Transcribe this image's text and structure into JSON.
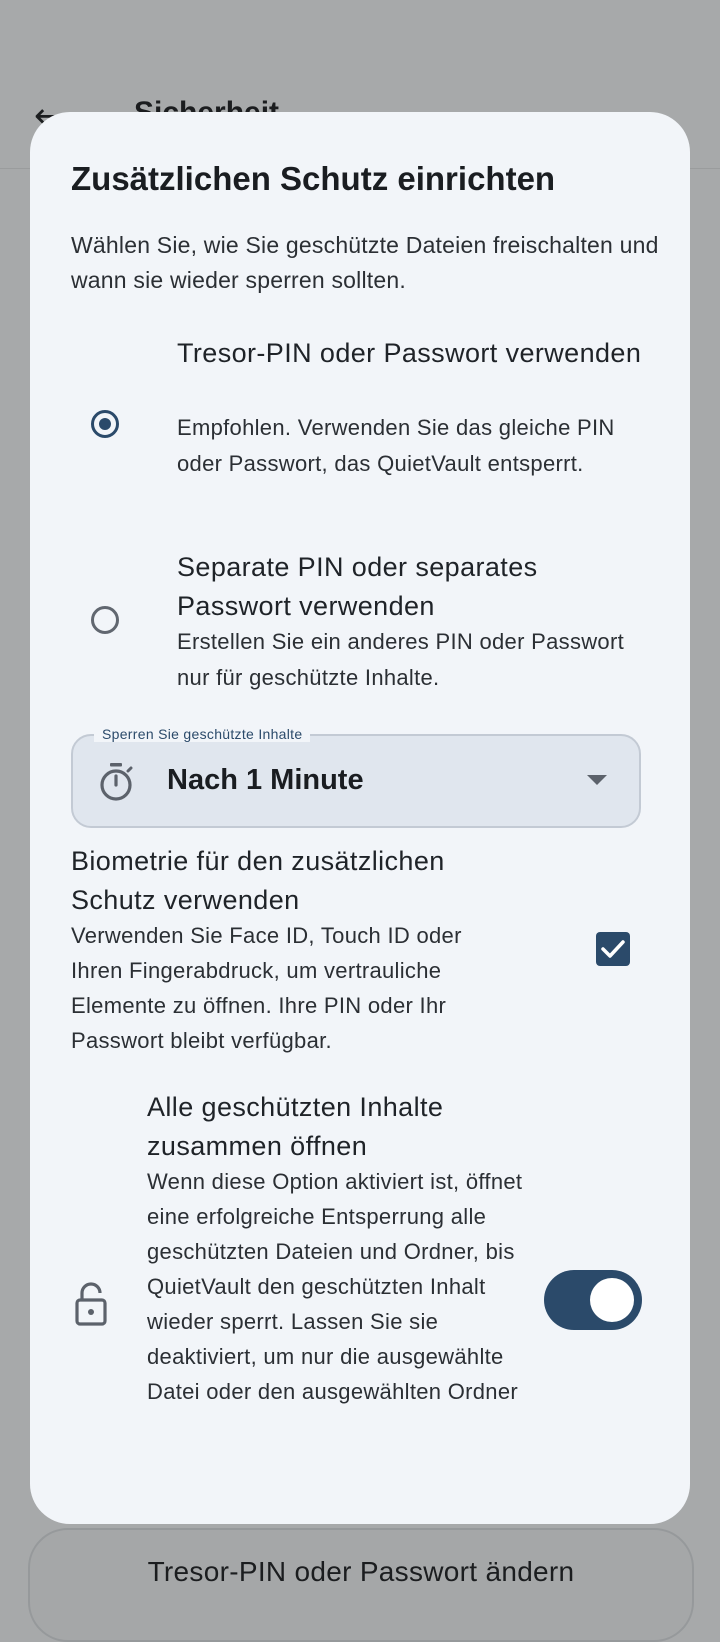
{
  "background": {
    "back_icon": "arrow-left-icon",
    "title": "Sicherheit",
    "bottom_button": "Tresor-PIN oder Passwort ändern"
  },
  "dialog": {
    "title": "Zusätzlichen Schutz einrichten",
    "description": "Wählen Sie, wie Sie geschützte Dateien freischalten und wann sie wieder sperren sollten.",
    "options": [
      {
        "title": "Tresor-PIN oder Passwort verwenden",
        "description": "Empfohlen. Verwenden Sie das gleiche PIN oder Passwort, das QuietVault entsperrt.",
        "selected": true
      },
      {
        "title": "Separate PIN oder separates Passwort verwenden",
        "description": "Erstellen Sie ein anderes PIN oder Passwort nur für geschützte Inhalte.",
        "selected": false
      }
    ],
    "lock_dropdown": {
      "label": "Sperren Sie geschützte Inhalte",
      "value": "Nach 1 Minute",
      "icon": "timer-icon"
    },
    "biometrics": {
      "title": "Biometrie für den zusätzlichen Schutz verwenden",
      "description": "Verwenden Sie Face ID, Touch ID oder Ihren Fingerabdruck, um vertrauliche Elemente zu öffnen. Ihre PIN oder Ihr Passwort bleibt verfügbar.",
      "checked": true
    },
    "unlock_all": {
      "title": "Alle geschützten Inhalte zusammen öffnen",
      "description": "Wenn diese Option aktiviert ist, öffnet eine erfolgreiche Entsperrung alle geschützten Dateien und Ordner, bis QuietVault den geschützten Inhalt wieder sperrt. Lassen Sie sie deaktiviert, um nur die ausgewählte Datei oder den ausgewählten Ordner",
      "icon": "unlock-icon",
      "enabled": true
    }
  },
  "colors": {
    "accent": "#2b4a6a",
    "dialog_bg": "#f2f5f9",
    "scrim": "#a7a9aa"
  }
}
